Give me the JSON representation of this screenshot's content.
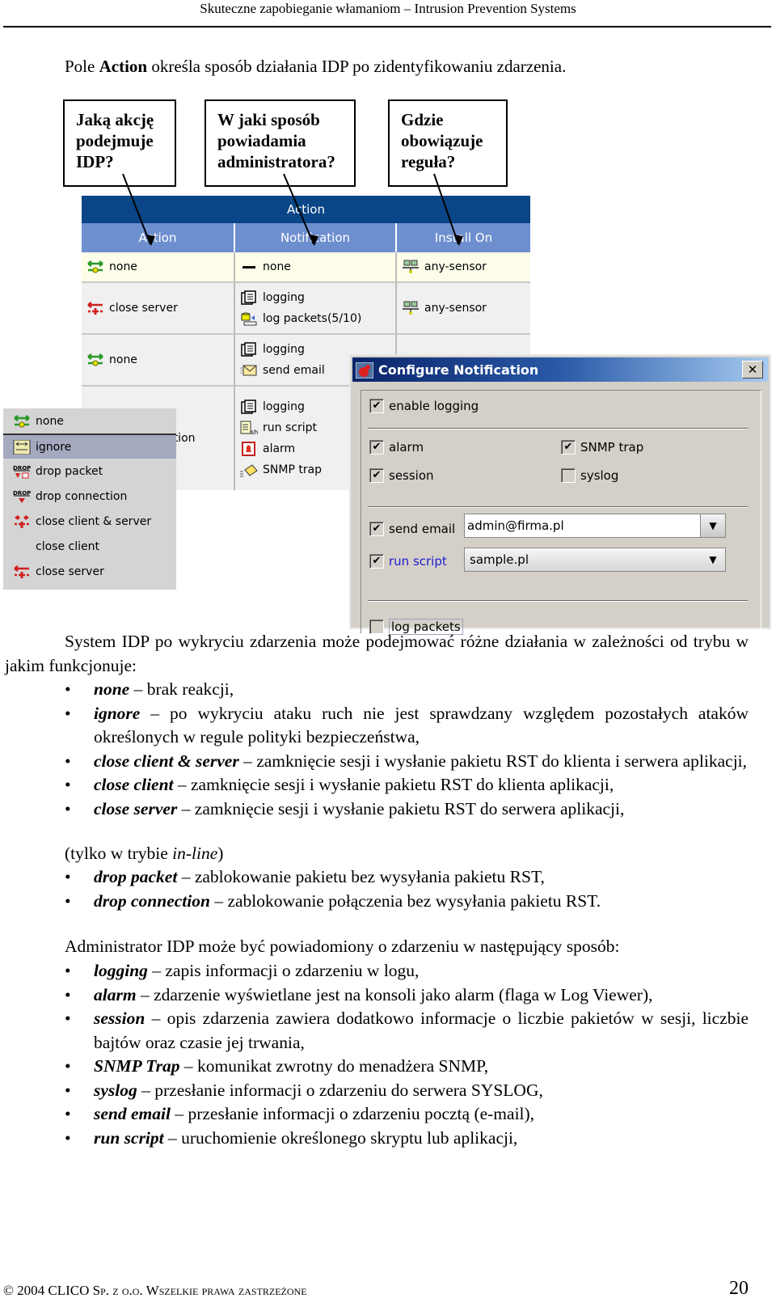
{
  "header": {
    "title": "Skuteczne zapobieganie włamaniom – Intrusion Prevention Systems"
  },
  "intro": {
    "prefix": "Pole ",
    "bold": "Action",
    "suffix": " określa sposób działania IDP po zidentyfikowaniu zdarzenia."
  },
  "callouts": [
    {
      "lines": [
        "Jaką akcję",
        "podejmuje",
        "IDP?"
      ]
    },
    {
      "lines": [
        "W jaki sposób",
        "powiadamia",
        "administratora?"
      ]
    },
    {
      "lines": [
        "Gdzie",
        "obowiązuje",
        "reguła?"
      ]
    }
  ],
  "grid": {
    "title": "Action",
    "columns": [
      "Action",
      "Notification",
      "Install On"
    ],
    "rows": [
      {
        "action": {
          "icon": "none-action-icon",
          "label": "none"
        },
        "notifications": [
          {
            "icon": "dash-icon",
            "label": "none"
          }
        ],
        "install_on": {
          "icon": "sensor-icon",
          "label": "any-sensor"
        }
      },
      {
        "action": {
          "icon": "close-server-icon",
          "label": "close server"
        },
        "notifications": [
          {
            "icon": "logging-icon",
            "label": "logging"
          },
          {
            "icon": "log-packets-icon",
            "label": "log packets(5/10)"
          }
        ],
        "install_on": {
          "icon": "sensor-icon",
          "label": "any-sensor"
        }
      },
      {
        "action": {
          "icon": "none-action-icon",
          "label": "none"
        },
        "notifications": [
          {
            "icon": "logging-icon",
            "label": "logging"
          },
          {
            "icon": "email-icon",
            "label": "send email"
          }
        ],
        "install_on": null
      },
      {
        "action": {
          "icon": "",
          "label": "ction"
        },
        "notifications": [
          {
            "icon": "logging-icon",
            "label": "logging"
          },
          {
            "icon": "script-icon",
            "label": "run script"
          },
          {
            "icon": "alarm-icon",
            "label": "alarm"
          },
          {
            "icon": "snmp-icon",
            "label": "SNMP trap"
          }
        ],
        "install_on": null
      }
    ]
  },
  "action_menu": {
    "selected": "ignore",
    "items": [
      {
        "icon": "none-action-icon",
        "label": "none"
      },
      {
        "icon": "ignore-icon",
        "label": "ignore"
      },
      {
        "icon": "drop-packet-icon",
        "label": "drop packet"
      },
      {
        "icon": "drop-connection-icon",
        "label": "drop connection"
      },
      {
        "icon": "close-client-server-icon",
        "label": "close client & server"
      },
      {
        "icon": "",
        "label": "close client"
      },
      {
        "icon": "close-server-icon",
        "label": "close server"
      }
    ]
  },
  "dialog": {
    "title": "Configure Notification",
    "close_label": "✕",
    "enable_logging": {
      "label": "enable logging",
      "checked": true
    },
    "alarm": {
      "label": "alarm",
      "checked": true
    },
    "snmp_trap": {
      "label": "SNMP trap",
      "checked": true
    },
    "session": {
      "label": "session",
      "checked": true
    },
    "syslog": {
      "label": "syslog",
      "checked": false
    },
    "send_email": {
      "label": "send email",
      "checked": true,
      "value": "admin@firma.pl"
    },
    "run_script": {
      "label": "run script",
      "checked": true,
      "value": "sample.pl"
    },
    "log_packets": {
      "label": "log packets",
      "checked": false
    },
    "link_color": "#1a1ad0"
  },
  "body": {
    "para1": "System IDP po wykryciu zdarzenia może podejmować różne działania w zależności od trybu w jakim funkcjonuje:",
    "actions": [
      {
        "term": "none",
        "desc": " – brak reakcji,"
      },
      {
        "term": "ignore",
        "desc": " – po wykryciu ataku ruch nie jest sprawdzany względem pozostałych ataków określonych w regule polityki bezpieczeństwa,"
      },
      {
        "term": "close client & server",
        "desc": " – zamknięcie sesji i wysłanie pakietu RST do klienta i serwera aplikacji,"
      },
      {
        "term": "close client",
        "desc": " – zamknięcie sesji i wysłanie pakietu RST do klienta aplikacji,"
      },
      {
        "term": "close server",
        "desc": " – zamknięcie sesji i wysłanie pakietu RST do serwera aplikacji,"
      }
    ],
    "inline_note": {
      "prefix": "(tylko w trybie ",
      "italic": "in-line",
      "suffix": ")"
    },
    "inline_actions": [
      {
        "term": "drop packet",
        "desc": " – zablokowanie pakietu bez wysyłania pakietu RST,"
      },
      {
        "term": "drop connection",
        "desc": " – zablokowanie połączenia bez wysyłania pakietu RST."
      }
    ],
    "para2": "Administrator IDP może być powiadomiony o zdarzeniu w następujący sposób:",
    "notifications": [
      {
        "term": "logging",
        "desc": " – zapis informacji o zdarzeniu w logu,"
      },
      {
        "term": "alarm",
        "desc": " – zdarzenie wyświetlane jest na konsoli jako alarm (flaga w Log Viewer),"
      },
      {
        "term": "session",
        "desc": " – opis zdarzenia zawiera dodatkowo informacje o liczbie pakietów w sesji, liczbie bajtów oraz czasie jej trwania,"
      },
      {
        "term": "SNMP Trap",
        "desc": " – komunikat zwrotny do menadżera SNMP,"
      },
      {
        "term": "syslog",
        "desc": " – przesłanie informacji o zdarzeniu do serwera SYSLOG,"
      },
      {
        "term": "send email",
        "desc": " – przesłanie informacji o zdarzeniu pocztą (e-mail),"
      },
      {
        "term": "run script",
        "desc": " – uruchomienie określonego skryptu lub aplikacji,"
      }
    ]
  },
  "footer": {
    "copyright": "© 2004 CLICO Sp. z o.o. Wszelkie prawa zastrzeżone",
    "page_number": "20"
  }
}
